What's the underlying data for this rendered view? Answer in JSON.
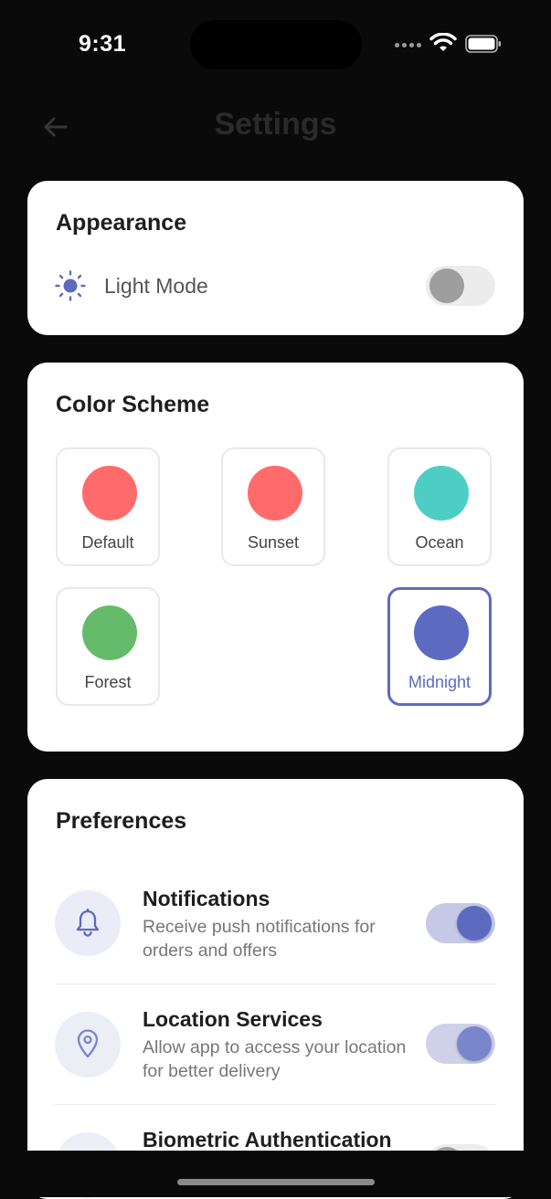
{
  "status_bar": {
    "time": "9:31"
  },
  "header": {
    "title": "Settings"
  },
  "appearance": {
    "title": "Appearance",
    "light_mode_label": "Light Mode",
    "light_mode_enabled": false
  },
  "color_scheme": {
    "title": "Color Scheme",
    "options": [
      {
        "label": "Default",
        "color": "#ff6b6b",
        "selected": false
      },
      {
        "label": "Sunset",
        "color": "#ff6b6b",
        "selected": false
      },
      {
        "label": "Ocean",
        "color": "#4ecdc4",
        "selected": false
      },
      {
        "label": "Forest",
        "color": "#66bb6a",
        "selected": false
      },
      {
        "label": "Midnight",
        "color": "#5c6bc0",
        "selected": true
      }
    ]
  },
  "preferences": {
    "title": "Preferences",
    "items": [
      {
        "title": "Notifications",
        "description": "Receive push notifications for orders and offers",
        "icon": "bell-icon",
        "enabled": true
      },
      {
        "title": "Location Services",
        "description": "Allow app to access your location for better delivery",
        "icon": "location-pin-icon",
        "enabled": true
      },
      {
        "title": "Biometric Authentication",
        "description": "",
        "icon": "fingerprint-icon",
        "enabled": false
      }
    ]
  },
  "colors": {
    "accent": "#5c6bc0",
    "card_background": "#ffffff",
    "screen_background": "#0a0a0a"
  }
}
